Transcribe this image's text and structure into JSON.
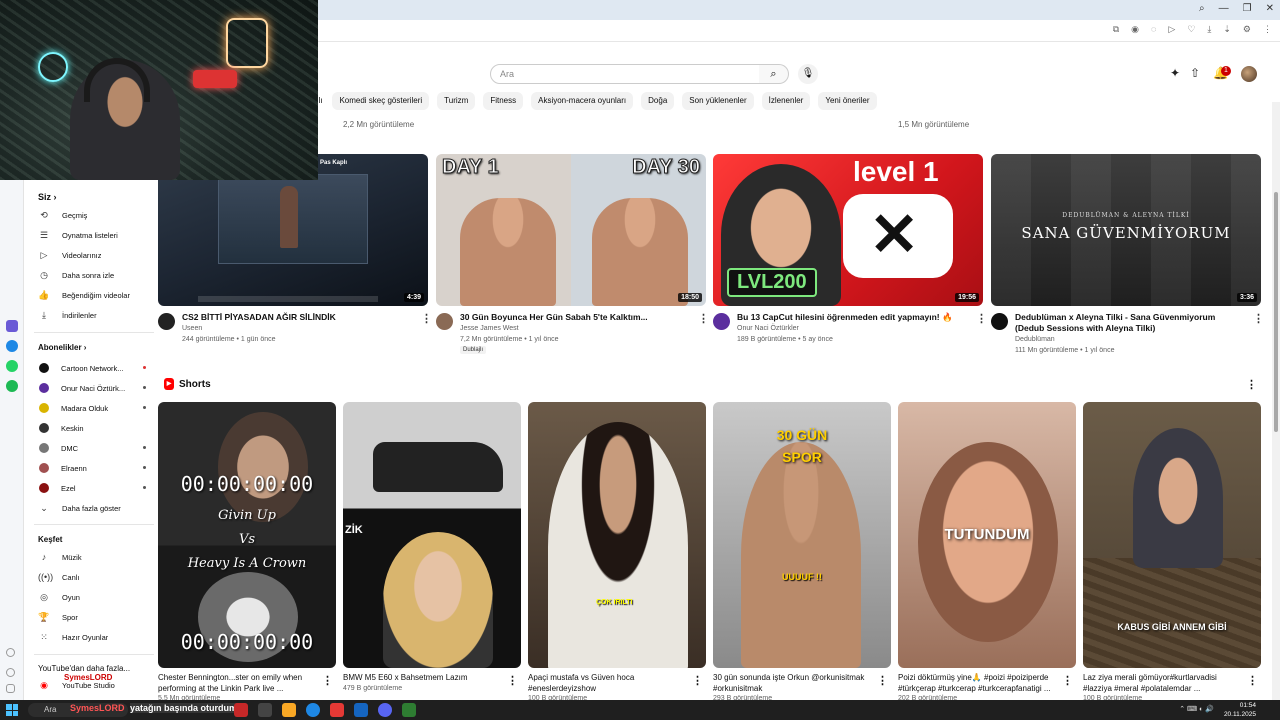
{
  "browser": {
    "window_controls": [
      "⌕",
      "—",
      "❐",
      "✕"
    ],
    "extensions": [
      "⧉",
      "◉",
      "◌",
      "▷",
      "♡",
      "⤓",
      "⇣",
      "⚙",
      "⋮"
    ]
  },
  "header": {
    "search_placeholder": "Ara",
    "search_icon": "search-icon",
    "mic_icon": "mic-icon",
    "create_icon": "create-icon",
    "upload_icon": "upload-icon",
    "notifications_count": "1"
  },
  "chips": [
    "nlı",
    "Komedi skeç gösterileri",
    "Turizm",
    "Fitness",
    "Aksiyon-macera oyunları",
    "Doğa",
    "Son yüklenenler",
    "İzlenenler",
    "Yeni öneriler"
  ],
  "prev_row_views": [
    "2,2 Mn görüntüleme",
    "1,5 Mn görüntüleme"
  ],
  "guide": {
    "you_label": "Siz",
    "you_items": [
      "Geçmiş",
      "Oynatma listeleri",
      "Videolarınız",
      "Daha sonra izle",
      "Beğendiğim videolar",
      "İndirilenler"
    ],
    "subs_label": "Abonelikler",
    "subs": [
      "Cartoon Network...",
      "Onur Naci Öztürk...",
      "Madara Olduk",
      "Keskin",
      "DMC",
      "Elraenn",
      "Ezel"
    ],
    "show_more": "Daha fazla göster",
    "explore_label": "Keşfet",
    "explore_items": [
      "Müzik",
      "Canlı",
      "Oyun",
      "Spor",
      "Hazır Oyunlar"
    ],
    "more_label": "YouTube'dan daha fazla...",
    "studio": "YouTube Studio"
  },
  "videos": [
    {
      "title": "CS2 BİTTİ PİYASADAN AĞIR SİLİNDİK",
      "channel": "Useen",
      "meta": "244 görüntüleme • 1 gün önce",
      "duration": "4:39",
      "thumb_label": "Pas Kaplı"
    },
    {
      "title": "30 Gün Boyunca Her Gün Sabah 5'te Kalktım...",
      "channel": "Jesse James West",
      "meta": "7,2 Mn görüntüleme • 1 yıl önce",
      "duration": "18:50",
      "badge": "Dublajlı",
      "cap_left": "DAY 1",
      "cap_right": "DAY 30"
    },
    {
      "title": "Bu 13 CapCut hilesini öğrenmeden edit yapmayın! 🔥",
      "channel": "Onur Naci Öztürkler",
      "meta": "189 B görüntüleme • 5 ay önce",
      "duration": "19:56",
      "cap_top": "level 1",
      "cap_bottom": "LVL200"
    },
    {
      "title": "Dedublüman x Aleyna Tilki - Sana Güvenmiyorum (Dedub Sessions with Aleyna Tilki)",
      "channel": "Dedublüman",
      "meta": "111 Mn görüntüleme • 1 yıl önce",
      "duration": "3:36",
      "cap_small": "DEDUBLÜMAN & ALEYNA TİLKİ",
      "cap_big": "SANA GÜVENMİYORUM"
    }
  ],
  "shorts": {
    "label": "Shorts",
    "items": [
      {
        "title": "Chester Bennington...ster on emily when performing at the Linkin Park live ...",
        "views": "5,5 Mn görüntüleme",
        "timer": "00:00:00:00",
        "hand1": "Givin Up",
        "hand2": "Vs",
        "hand3": "Heavy Is A Crown"
      },
      {
        "title": "BMW M5 E60 x Bahsetmem Lazım",
        "views": "479 B görüntüleme",
        "cap": "ZİK"
      },
      {
        "title": "Apaçi mustafa vs Güven hoca #eneslerdeyizshow",
        "views": "100 B görüntüleme",
        "cap": "ÇOK IRILTI"
      },
      {
        "title": "30 gün sonunda işte Orkun @orkunisitmak #orkunisitmak",
        "views": "293 B görüntüleme",
        "cap1": "30 GÜN",
        "cap2": "SPOR",
        "cap3": "UUUUF !!"
      },
      {
        "title": "Poizi döktürmüş yine🙏 #poizi #poiziperde #türkçerap #turkcerap #turkcerapfanatigi ...",
        "views": "202 B görüntüleme",
        "cap": "TUTUNDUM"
      },
      {
        "title": "Laz ziya merali gömüyor#kurtlarvadisi #lazziya #meral #polatalemdar ...",
        "views": "100 B görüntüleme",
        "cap": "KABUS GİBİ ANNEM GİBİ"
      }
    ]
  },
  "overlay": {
    "streamer": "SymesLORD",
    "subtitle": "yatağın başında oturdum"
  },
  "taskbar": {
    "search": "Ara",
    "time": "01:54",
    "date": "20.11.2025"
  },
  "colors": {
    "accent": "#ff0000",
    "text": "#0f0f0f",
    "meta": "#606060"
  }
}
